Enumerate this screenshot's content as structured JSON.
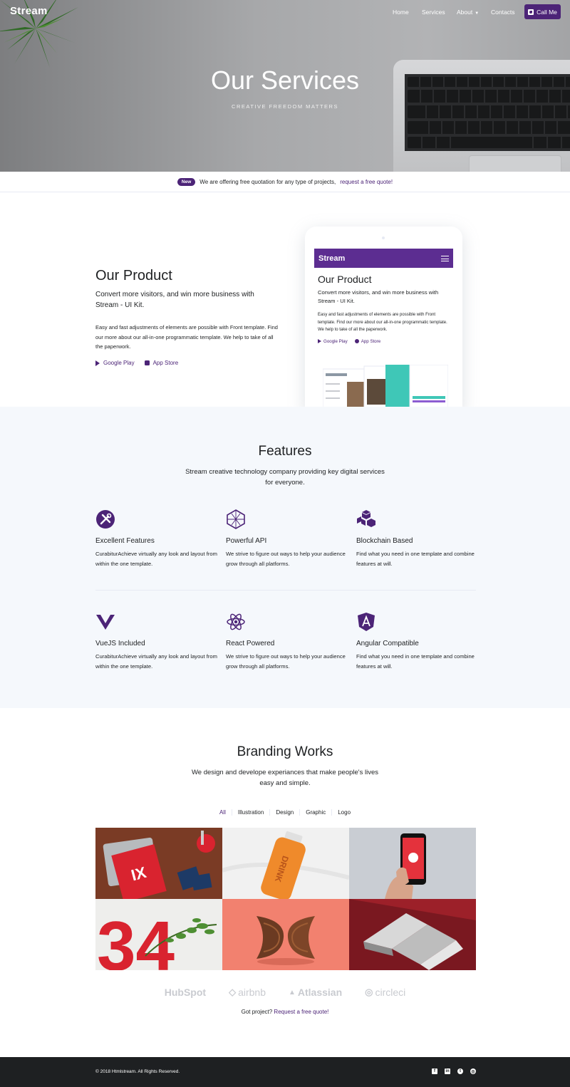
{
  "nav": {
    "brand": "Stream",
    "links": [
      "Home",
      "Services",
      "About",
      "Contacts"
    ],
    "cta": "Call Me"
  },
  "hero": {
    "title": "Our Services",
    "subtitle": "CREATIVE FREEDOM MATTERS"
  },
  "promo": {
    "badge": "New",
    "text": "We are offering free quotation for any type of projects,",
    "link": "request a free quote!"
  },
  "product": {
    "title": "Our Product",
    "lead": "Convert more visitors, and win more business with Stream - UI Kit.",
    "text": "Easy and fast adjustments of elements are possible with Front template. Find our more about our all-in-one programmatic template. We help to take of all the paperwork.",
    "google_play": "Google Play",
    "app_store": "App Store",
    "device": {
      "brand": "Stream",
      "title": "Our Product",
      "lead": "Convert more visitors, and win more business with Stream - UI Kit.",
      "text": "Easy and fast adjustments of elements are possible with Front template. Find our more about our all-in-one programmatic template. We help to take of all the paperwork.",
      "google_play": "Google Play",
      "app_store": "App Store"
    }
  },
  "features": {
    "title": "Features",
    "lead": "Stream creative technology company providing key digital services for everyone.",
    "items": [
      {
        "icon": "tools-icon",
        "title": "Excellent Features",
        "text": "CurabiturAchieve virtually any look and layout from within the one template."
      },
      {
        "icon": "hexagon-api-icon",
        "title": "Powerful API",
        "text": "We strive to figure out ways to help your audience grow through all platforms."
      },
      {
        "icon": "blocks-icon",
        "title": "Blockchain Based",
        "text": "Find what you need in one template and combine features at will."
      },
      {
        "icon": "vuejs-icon",
        "title": "VueJS Included",
        "text": "CurabiturAchieve virtually any look and layout from within the one template."
      },
      {
        "icon": "react-icon",
        "title": "React Powered",
        "text": "We strive to figure out ways to help your audience grow through all platforms."
      },
      {
        "icon": "angular-icon",
        "title": "Angular Compatible",
        "text": "Find what you need in one template and combine features at will."
      }
    ]
  },
  "branding": {
    "title": "Branding Works",
    "lead": "We design and develope experiances that make people's lives easy and simple.",
    "filters": [
      "All",
      "Illustration",
      "Design",
      "Graphic",
      "Logo"
    ],
    "active_filter": "All",
    "logos": [
      "HubSpot",
      "airbnb",
      "Atlassian",
      "circleci"
    ],
    "got_text": "Got project?",
    "got_link": "Request a free quote!"
  },
  "footer": {
    "copyright": "© 2018 Htmlstream. All Rights Reserved.",
    "social": [
      "facebook-icon",
      "linkedin-icon",
      "twitter-icon",
      "dribbble-icon"
    ]
  },
  "colors": {
    "primary": "#4c2477",
    "device_bar": "#5c2d91",
    "features_bg": "#f5f8fc",
    "footer_bg": "#1e2022"
  }
}
